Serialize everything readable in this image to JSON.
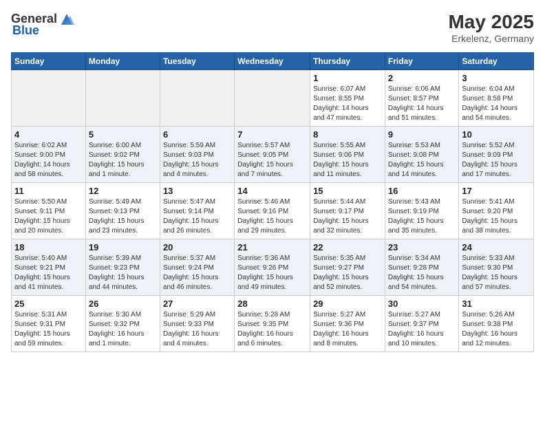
{
  "header": {
    "logo_general": "General",
    "logo_blue": "Blue",
    "title": "May 2025",
    "subtitle": "Erkelenz, Germany"
  },
  "days_of_week": [
    "Sunday",
    "Monday",
    "Tuesday",
    "Wednesday",
    "Thursday",
    "Friday",
    "Saturday"
  ],
  "weeks": [
    [
      {
        "day": "",
        "info": ""
      },
      {
        "day": "",
        "info": ""
      },
      {
        "day": "",
        "info": ""
      },
      {
        "day": "",
        "info": ""
      },
      {
        "day": "1",
        "info": "Sunrise: 6:07 AM\nSunset: 8:55 PM\nDaylight: 14 hours\nand 47 minutes."
      },
      {
        "day": "2",
        "info": "Sunrise: 6:06 AM\nSunset: 8:57 PM\nDaylight: 14 hours\nand 51 minutes."
      },
      {
        "day": "3",
        "info": "Sunrise: 6:04 AM\nSunset: 8:58 PM\nDaylight: 14 hours\nand 54 minutes."
      }
    ],
    [
      {
        "day": "4",
        "info": "Sunrise: 6:02 AM\nSunset: 9:00 PM\nDaylight: 14 hours\nand 58 minutes."
      },
      {
        "day": "5",
        "info": "Sunrise: 6:00 AM\nSunset: 9:02 PM\nDaylight: 15 hours\nand 1 minute."
      },
      {
        "day": "6",
        "info": "Sunrise: 5:59 AM\nSunset: 9:03 PM\nDaylight: 15 hours\nand 4 minutes."
      },
      {
        "day": "7",
        "info": "Sunrise: 5:57 AM\nSunset: 9:05 PM\nDaylight: 15 hours\nand 7 minutes."
      },
      {
        "day": "8",
        "info": "Sunrise: 5:55 AM\nSunset: 9:06 PM\nDaylight: 15 hours\nand 11 minutes."
      },
      {
        "day": "9",
        "info": "Sunrise: 5:53 AM\nSunset: 9:08 PM\nDaylight: 15 hours\nand 14 minutes."
      },
      {
        "day": "10",
        "info": "Sunrise: 5:52 AM\nSunset: 9:09 PM\nDaylight: 15 hours\nand 17 minutes."
      }
    ],
    [
      {
        "day": "11",
        "info": "Sunrise: 5:50 AM\nSunset: 9:11 PM\nDaylight: 15 hours\nand 20 minutes."
      },
      {
        "day": "12",
        "info": "Sunrise: 5:49 AM\nSunset: 9:13 PM\nDaylight: 15 hours\nand 23 minutes."
      },
      {
        "day": "13",
        "info": "Sunrise: 5:47 AM\nSunset: 9:14 PM\nDaylight: 15 hours\nand 26 minutes."
      },
      {
        "day": "14",
        "info": "Sunrise: 5:46 AM\nSunset: 9:16 PM\nDaylight: 15 hours\nand 29 minutes."
      },
      {
        "day": "15",
        "info": "Sunrise: 5:44 AM\nSunset: 9:17 PM\nDaylight: 15 hours\nand 32 minutes."
      },
      {
        "day": "16",
        "info": "Sunrise: 5:43 AM\nSunset: 9:19 PM\nDaylight: 15 hours\nand 35 minutes."
      },
      {
        "day": "17",
        "info": "Sunrise: 5:41 AM\nSunset: 9:20 PM\nDaylight: 15 hours\nand 38 minutes."
      }
    ],
    [
      {
        "day": "18",
        "info": "Sunrise: 5:40 AM\nSunset: 9:21 PM\nDaylight: 15 hours\nand 41 minutes."
      },
      {
        "day": "19",
        "info": "Sunrise: 5:39 AM\nSunset: 9:23 PM\nDaylight: 15 hours\nand 44 minutes."
      },
      {
        "day": "20",
        "info": "Sunrise: 5:37 AM\nSunset: 9:24 PM\nDaylight: 15 hours\nand 46 minutes."
      },
      {
        "day": "21",
        "info": "Sunrise: 5:36 AM\nSunset: 9:26 PM\nDaylight: 15 hours\nand 49 minutes."
      },
      {
        "day": "22",
        "info": "Sunrise: 5:35 AM\nSunset: 9:27 PM\nDaylight: 15 hours\nand 52 minutes."
      },
      {
        "day": "23",
        "info": "Sunrise: 5:34 AM\nSunset: 9:28 PM\nDaylight: 15 hours\nand 54 minutes."
      },
      {
        "day": "24",
        "info": "Sunrise: 5:33 AM\nSunset: 9:30 PM\nDaylight: 15 hours\nand 57 minutes."
      }
    ],
    [
      {
        "day": "25",
        "info": "Sunrise: 5:31 AM\nSunset: 9:31 PM\nDaylight: 15 hours\nand 59 minutes."
      },
      {
        "day": "26",
        "info": "Sunrise: 5:30 AM\nSunset: 9:32 PM\nDaylight: 16 hours\nand 1 minute."
      },
      {
        "day": "27",
        "info": "Sunrise: 5:29 AM\nSunset: 9:33 PM\nDaylight: 16 hours\nand 4 minutes."
      },
      {
        "day": "28",
        "info": "Sunrise: 5:28 AM\nSunset: 9:35 PM\nDaylight: 16 hours\nand 6 minutes."
      },
      {
        "day": "29",
        "info": "Sunrise: 5:27 AM\nSunset: 9:36 PM\nDaylight: 16 hours\nand 8 minutes."
      },
      {
        "day": "30",
        "info": "Sunrise: 5:27 AM\nSunset: 9:37 PM\nDaylight: 16 hours\nand 10 minutes."
      },
      {
        "day": "31",
        "info": "Sunrise: 5:26 AM\nSunset: 9:38 PM\nDaylight: 16 hours\nand 12 minutes."
      }
    ]
  ]
}
